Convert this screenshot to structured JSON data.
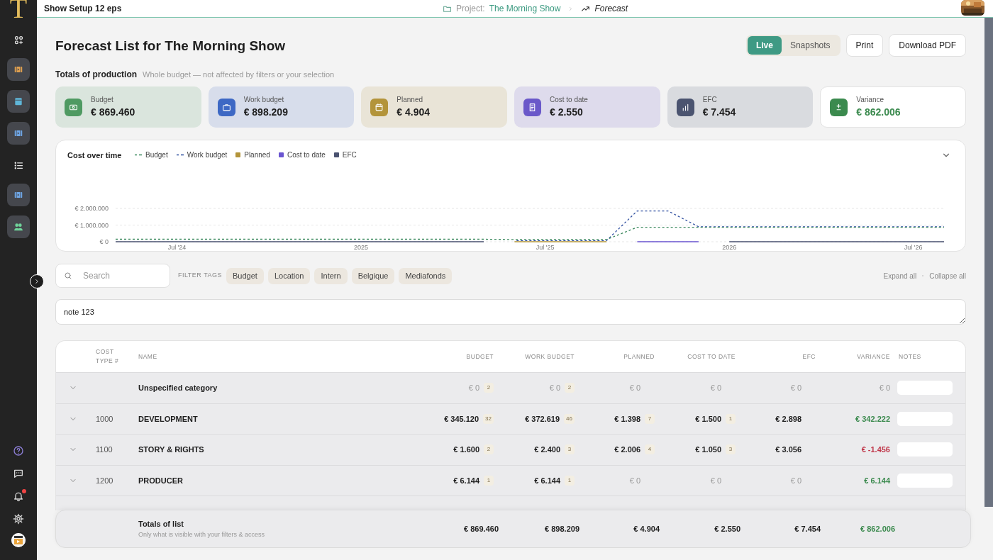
{
  "sidebar": {
    "logo": "T",
    "items": [
      {
        "kind": "plain"
      },
      {
        "kind": "button",
        "color": "#e0a050"
      },
      {
        "kind": "button",
        "color": "#5fb6d9"
      },
      {
        "kind": "button",
        "color": "#6fa6e6"
      },
      {
        "kind": "plain"
      },
      {
        "kind": "button",
        "color": "#6fa6e6"
      },
      {
        "kind": "button",
        "color": "#6fd39a"
      }
    ],
    "bottom": [
      {
        "badge": false
      },
      {
        "badge": false
      },
      {
        "badge": true
      },
      {
        "badge": false
      }
    ]
  },
  "topbar": {
    "title": "Show Setup 12 eps",
    "breadcrumb": {
      "prefix": "Project:",
      "project": "The Morning Show",
      "page": "Forecast"
    }
  },
  "page": {
    "title": "Forecast List for The Morning Show",
    "modes": [
      {
        "label": "Live",
        "selected": true
      },
      {
        "label": "Snapshots",
        "selected": false
      }
    ],
    "buttons": [
      "Print",
      "Download PDF"
    ]
  },
  "totals": {
    "title": "Totals of production",
    "subtitle": "Whole budget — not affected by filters or your selection",
    "cards": [
      {
        "label": "Budget",
        "value": "€ 869.460",
        "kind": "tinted",
        "color": "#4f9a62"
      },
      {
        "label": "Work budget",
        "value": "€ 898.209",
        "kind": "tinted",
        "color": "#3d68c4"
      },
      {
        "label": "Planned",
        "value": "€ 4.904",
        "kind": "tinted",
        "color": "#b3943a"
      },
      {
        "label": "Cost to date",
        "value": "€ 2.550",
        "kind": "tinted",
        "color": "#6a58c9"
      },
      {
        "label": "EFC",
        "value": "€ 7.454",
        "kind": "tinted",
        "color": "#4b5470"
      },
      {
        "label": "Variance",
        "value": "€ 862.006",
        "kind": "variance",
        "color": "#3b8a4e"
      }
    ]
  },
  "chart": {
    "title": "Cost over time",
    "chart_data": {
      "type": "line",
      "categories": [
        null,
        null,
        "Jul '24",
        null,
        null,
        null,
        null,
        null,
        "2025",
        null,
        null,
        null,
        null,
        null,
        "Jul '25",
        null,
        null,
        null,
        null,
        null,
        "2026",
        null,
        null,
        null,
        null,
        null,
        "Jul '26",
        null
      ],
      "yticks": [
        {
          "value": 0,
          "label": "€ 0"
        },
        {
          "value": 1000000,
          "label": "€ 1.000.000"
        },
        {
          "value": 2000000,
          "label": "€ 2.000.000"
        }
      ],
      "ylim": [
        0,
        2000000
      ],
      "legend": "top-left",
      "series": [
        {
          "name": "Budget",
          "color": "#3d8a5f",
          "line_style": "dashed",
          "values": [
            150000,
            150000,
            150000,
            150000,
            150000,
            150000,
            150000,
            150000,
            150000,
            150000,
            150000,
            150000,
            150000,
            130000,
            130000,
            130000,
            130000,
            870000,
            870000,
            870000,
            870000,
            870000,
            870000,
            870000,
            870000,
            870000,
            870000,
            870000
          ]
        },
        {
          "name": "Work budget",
          "color": "#2f4fa0",
          "line_style": "dashed",
          "values": [
            null,
            null,
            null,
            null,
            null,
            null,
            null,
            null,
            null,
            null,
            null,
            null,
            null,
            70000,
            70000,
            70000,
            70000,
            1850000,
            1850000,
            900000,
            900000,
            900000,
            900000,
            900000,
            900000,
            900000,
            900000,
            900000
          ]
        },
        {
          "name": "Planned",
          "color": "#b3943a",
          "line_style": "solid",
          "values": [
            null,
            null,
            null,
            null,
            null,
            null,
            null,
            null,
            null,
            null,
            null,
            null,
            null,
            0,
            0,
            0,
            0,
            null,
            null,
            null,
            null,
            null,
            null,
            null,
            null,
            null,
            null,
            null
          ]
        },
        {
          "name": "Cost to date",
          "color": "#6a55d0",
          "line_style": "solid",
          "values": [
            null,
            null,
            null,
            null,
            null,
            null,
            null,
            null,
            null,
            null,
            null,
            null,
            null,
            null,
            null,
            null,
            null,
            0,
            0,
            0,
            null,
            null,
            null,
            null,
            null,
            null,
            null,
            null
          ]
        },
        {
          "name": "EFC",
          "color": "#4a5270",
          "line_style": "solid",
          "values": [
            0,
            0,
            0,
            0,
            0,
            0,
            0,
            0,
            0,
            0,
            0,
            0,
            0,
            null,
            null,
            null,
            null,
            null,
            null,
            null,
            0,
            0,
            0,
            0,
            0,
            0,
            0,
            0
          ]
        }
      ]
    }
  },
  "filters": {
    "search_placeholder": "Search",
    "tags_label": "FILTER TAGS",
    "tags": [
      "Budget",
      "Location",
      "Intern",
      "Belgique",
      "Mediafonds"
    ],
    "expand": "Expand all",
    "collapse": "Collapse all"
  },
  "note": {
    "value": "note 123"
  },
  "table": {
    "columns": [
      "COST TYPE #",
      "NAME",
      "BUDGET",
      "WORK BUDGET",
      "PLANNED",
      "COST TO DATE",
      "EFC",
      "VARIANCE",
      "NOTES"
    ],
    "rows": [
      {
        "cells": [
          "",
          "Unspecified category",
          {
            "value": "€ 0",
            "count": "2",
            "muted": true
          },
          {
            "value": "€ 0",
            "count": "2",
            "muted": true
          },
          {
            "value": "€ 0",
            "muted": true
          },
          {
            "value": "€ 0",
            "muted": true
          },
          {
            "value": "€ 0",
            "muted": true
          },
          {
            "value": "€ 0",
            "color": "#999999"
          }
        ]
      },
      {
        "cells": [
          "1000",
          "DEVELOPMENT",
          {
            "value": "€ 345.120",
            "count": "32",
            "muted": false
          },
          {
            "value": "€ 372.619",
            "count": "46",
            "muted": false
          },
          {
            "value": "€ 1.398",
            "count": "7",
            "muted": false
          },
          {
            "value": "€ 1.500",
            "count": "1",
            "muted": false
          },
          {
            "value": "€ 2.898",
            "muted": false
          },
          {
            "value": "€ 342.222",
            "color": "#3b8a4e"
          }
        ]
      },
      {
        "cells": [
          "1100",
          "STORY & RIGHTS",
          {
            "value": "€ 1.600",
            "count": "2",
            "muted": false
          },
          {
            "value": "€ 2.400",
            "count": "3",
            "muted": false
          },
          {
            "value": "€ 2.006",
            "count": "4",
            "muted": false
          },
          {
            "value": "€ 1.050",
            "count": "3",
            "muted": false
          },
          {
            "value": "€ 3.056",
            "muted": false
          },
          {
            "value": "€ -1.456",
            "color": "#c0374a"
          }
        ]
      },
      {
        "cells": [
          "1200",
          "PRODUCER",
          {
            "value": "€ 6.144",
            "count": "1",
            "muted": false
          },
          {
            "value": "€ 6.144",
            "count": "1",
            "muted": false
          },
          {
            "value": "€ 0",
            "muted": true
          },
          {
            "value": "€ 0",
            "muted": true
          },
          {
            "value": "€ 0",
            "muted": true
          },
          {
            "value": "€ 6.144",
            "color": "#3b8a4e"
          }
        ]
      }
    ],
    "totals": {
      "title": "Totals of list",
      "subtitle": "Only what is visible with your filters & access",
      "values": [
        "€ 869.460",
        "€ 898.209",
        "€ 4.904",
        "€ 2.550",
        "€ 7.454"
      ],
      "variance": "€ 862.006"
    }
  }
}
